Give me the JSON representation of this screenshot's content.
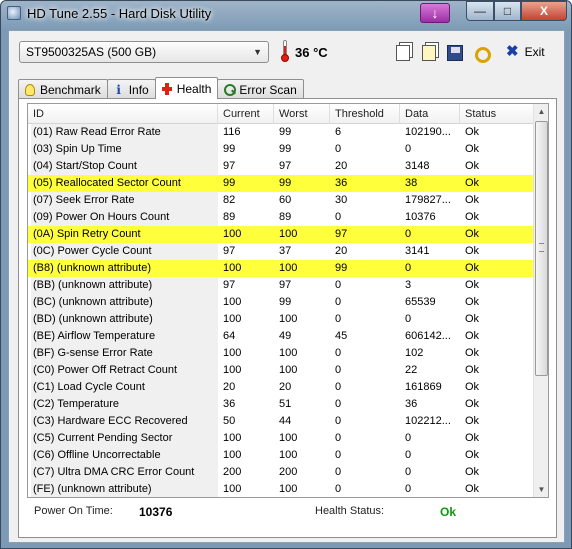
{
  "window": {
    "title": "HD Tune 2.55 - Hard Disk Utility",
    "controls": {
      "minimize": "—",
      "maximize": "□",
      "close": "X"
    }
  },
  "toolbar": {
    "drive": "ST9500325AS (500 GB)",
    "temperature": "36 °C",
    "exit_label": "Exit"
  },
  "tabs": [
    {
      "label": "Benchmark",
      "icon": "bulb-icon"
    },
    {
      "label": "Info",
      "icon": "info-icon"
    },
    {
      "label": "Health",
      "icon": "health-cross-icon",
      "active": true
    },
    {
      "label": "Error Scan",
      "icon": "magnifier-icon"
    }
  ],
  "table": {
    "columns": [
      "ID",
      "Current",
      "Worst",
      "Threshold",
      "Data",
      "Status"
    ],
    "rows": [
      {
        "id": "(01) Raw Read Error Rate",
        "current": "116",
        "worst": "99",
        "threshold": "6",
        "data": "102190...",
        "status": "Ok",
        "highlight": false
      },
      {
        "id": "(03) Spin Up Time",
        "current": "99",
        "worst": "99",
        "threshold": "0",
        "data": "0",
        "status": "Ok",
        "highlight": false
      },
      {
        "id": "(04) Start/Stop Count",
        "current": "97",
        "worst": "97",
        "threshold": "20",
        "data": "3148",
        "status": "Ok",
        "highlight": false
      },
      {
        "id": "(05) Reallocated Sector Count",
        "current": "99",
        "worst": "99",
        "threshold": "36",
        "data": "38",
        "status": "Ok",
        "highlight": true
      },
      {
        "id": "(07) Seek Error Rate",
        "current": "82",
        "worst": "60",
        "threshold": "30",
        "data": "179827...",
        "status": "Ok",
        "highlight": false
      },
      {
        "id": "(09) Power On Hours Count",
        "current": "89",
        "worst": "89",
        "threshold": "0",
        "data": "10376",
        "status": "Ok",
        "highlight": false
      },
      {
        "id": "(0A) Spin Retry Count",
        "current": "100",
        "worst": "100",
        "threshold": "97",
        "data": "0",
        "status": "Ok",
        "highlight": true
      },
      {
        "id": "(0C) Power Cycle Count",
        "current": "97",
        "worst": "37",
        "threshold": "20",
        "data": "3141",
        "status": "Ok",
        "highlight": false
      },
      {
        "id": "(B8) (unknown attribute)",
        "current": "100",
        "worst": "100",
        "threshold": "99",
        "data": "0",
        "status": "Ok",
        "highlight": true
      },
      {
        "id": "(BB) (unknown attribute)",
        "current": "97",
        "worst": "97",
        "threshold": "0",
        "data": "3",
        "status": "Ok",
        "highlight": false
      },
      {
        "id": "(BC) (unknown attribute)",
        "current": "100",
        "worst": "99",
        "threshold": "0",
        "data": "65539",
        "status": "Ok",
        "highlight": false
      },
      {
        "id": "(BD) (unknown attribute)",
        "current": "100",
        "worst": "100",
        "threshold": "0",
        "data": "0",
        "status": "Ok",
        "highlight": false
      },
      {
        "id": "(BE) Airflow Temperature",
        "current": "64",
        "worst": "49",
        "threshold": "45",
        "data": "606142...",
        "status": "Ok",
        "highlight": false
      },
      {
        "id": "(BF) G-sense Error Rate",
        "current": "100",
        "worst": "100",
        "threshold": "0",
        "data": "102",
        "status": "Ok",
        "highlight": false
      },
      {
        "id": "(C0) Power Off Retract Count",
        "current": "100",
        "worst": "100",
        "threshold": "0",
        "data": "22",
        "status": "Ok",
        "highlight": false
      },
      {
        "id": "(C1) Load Cycle Count",
        "current": "20",
        "worst": "20",
        "threshold": "0",
        "data": "161869",
        "status": "Ok",
        "highlight": false
      },
      {
        "id": "(C2) Temperature",
        "current": "36",
        "worst": "51",
        "threshold": "0",
        "data": "36",
        "status": "Ok",
        "highlight": false
      },
      {
        "id": "(C3) Hardware ECC Recovered",
        "current": "50",
        "worst": "44",
        "threshold": "0",
        "data": "102212...",
        "status": "Ok",
        "highlight": false
      },
      {
        "id": "(C5) Current Pending Sector",
        "current": "100",
        "worst": "100",
        "threshold": "0",
        "data": "0",
        "status": "Ok",
        "highlight": false
      },
      {
        "id": "(C6) Offline Uncorrectable",
        "current": "100",
        "worst": "100",
        "threshold": "0",
        "data": "0",
        "status": "Ok",
        "highlight": false
      },
      {
        "id": "(C7) Ultra DMA CRC Error Count",
        "current": "200",
        "worst": "200",
        "threshold": "0",
        "data": "0",
        "status": "Ok",
        "highlight": false
      },
      {
        "id": "(FE) (unknown attribute)",
        "current": "100",
        "worst": "100",
        "threshold": "0",
        "data": "0",
        "status": "Ok",
        "highlight": false
      }
    ]
  },
  "footer": {
    "power_on_label": "Power On Time:",
    "power_on_value": "10376",
    "health_label": "Health Status:",
    "health_value": "Ok"
  },
  "colors": {
    "highlight_row": "#ffff3c",
    "health_ok": "#0c9a0c"
  }
}
